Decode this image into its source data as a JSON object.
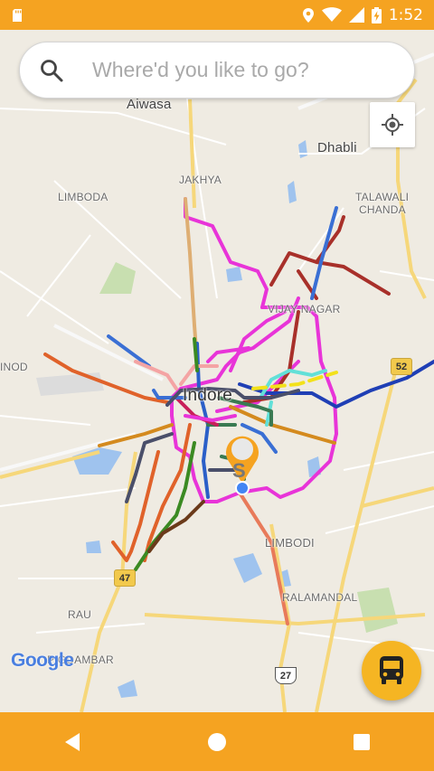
{
  "status_bar": {
    "time": "1:52",
    "icons": [
      "sd-card-icon",
      "location-icon",
      "wifi-icon",
      "signal-icon",
      "battery-charging-icon"
    ]
  },
  "search": {
    "placeholder": "Where'd you like to go?",
    "value": ""
  },
  "map": {
    "city_label": "Indore",
    "places": {
      "aiwasa": "Aiwasa",
      "dhabli": "Dhabli",
      "jakhya": "JAKHYA",
      "limboda": "LIMBODA",
      "talawali": "TALAWALI",
      "chanda": "CHANDA",
      "vijay_nagar": "VIJAY NAGAR",
      "inod": "INOD",
      "limbodi": "LIMBODI",
      "ralamandal": "RALAMANDAL",
      "rau": "RAU",
      "pigdambar": "PIGDAMBAR"
    },
    "highways": {
      "h52": "52",
      "h47": "47",
      "h27": "27"
    },
    "marker_letter": "S",
    "attribution": "Google",
    "colors": {
      "magenta_route": "#e834d8",
      "blue_route": "#1f3fb5",
      "brown_route": "#a8302a",
      "orange_route": "#e0622a",
      "marker": "#f5a321",
      "current_location": "#4285f4"
    }
  },
  "buttons": {
    "locate": "my-location-icon",
    "bus": "bus-icon"
  },
  "nav_bar": {
    "back": "back-icon",
    "home": "home-icon",
    "recents": "recents-icon"
  }
}
